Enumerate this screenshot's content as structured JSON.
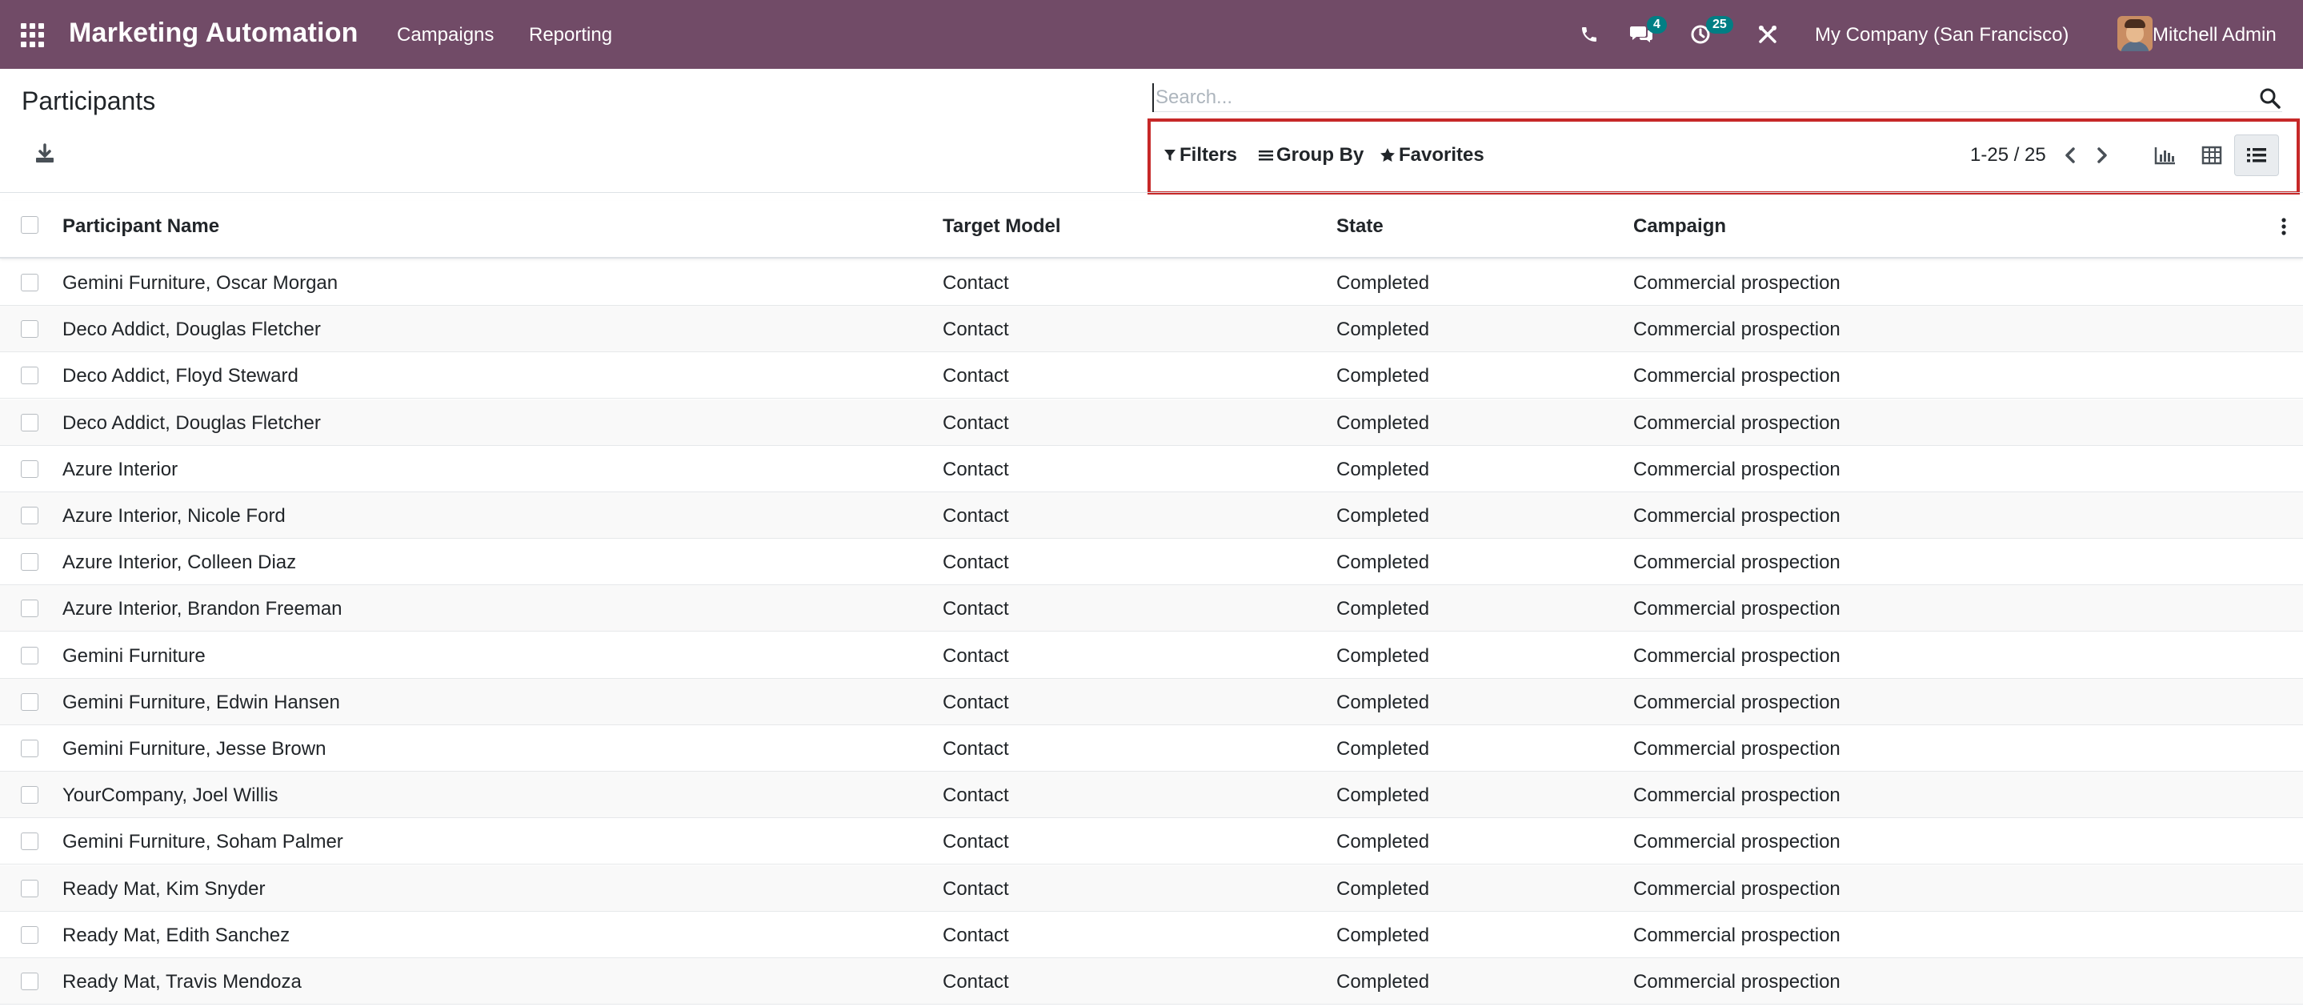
{
  "navbar": {
    "app_title": "Marketing Automation",
    "menus": [
      "Campaigns",
      "Reporting"
    ],
    "messages_count": "4",
    "activities_count": "25",
    "company": "My Company (San Francisco)",
    "user": "Mitchell Admin",
    "bg_color": "#714B67"
  },
  "control_panel": {
    "title": "Participants",
    "search_placeholder": "Search...",
    "filters_label": "Filters",
    "group_by_label": "Group By",
    "favorites_label": "Favorites",
    "pager": "1-25 / 25"
  },
  "table": {
    "columns": [
      "Participant Name",
      "Target Model",
      "State",
      "Campaign"
    ],
    "rows": [
      [
        "Gemini Furniture, Oscar Morgan",
        "Contact",
        "Completed",
        "Commercial prospection"
      ],
      [
        "Deco Addict, Douglas Fletcher",
        "Contact",
        "Completed",
        "Commercial prospection"
      ],
      [
        "Deco Addict, Floyd Steward",
        "Contact",
        "Completed",
        "Commercial prospection"
      ],
      [
        "Deco Addict, Douglas Fletcher",
        "Contact",
        "Completed",
        "Commercial prospection"
      ],
      [
        "Azure Interior",
        "Contact",
        "Completed",
        "Commercial prospection"
      ],
      [
        "Azure Interior, Nicole Ford",
        "Contact",
        "Completed",
        "Commercial prospection"
      ],
      [
        "Azure Interior, Colleen Diaz",
        "Contact",
        "Completed",
        "Commercial prospection"
      ],
      [
        "Azure Interior, Brandon Freeman",
        "Contact",
        "Completed",
        "Commercial prospection"
      ],
      [
        "Gemini Furniture",
        "Contact",
        "Completed",
        "Commercial prospection"
      ],
      [
        "Gemini Furniture, Edwin Hansen",
        "Contact",
        "Completed",
        "Commercial prospection"
      ],
      [
        "Gemini Furniture, Jesse Brown",
        "Contact",
        "Completed",
        "Commercial prospection"
      ],
      [
        "YourCompany, Joel Willis",
        "Contact",
        "Completed",
        "Commercial prospection"
      ],
      [
        "Gemini Furniture, Soham Palmer",
        "Contact",
        "Completed",
        "Commercial prospection"
      ],
      [
        "Ready Mat, Kim Snyder",
        "Contact",
        "Completed",
        "Commercial prospection"
      ],
      [
        "Ready Mat, Edith Sanchez",
        "Contact",
        "Completed",
        "Commercial prospection"
      ],
      [
        "Ready Mat, Travis Mendoza",
        "Contact",
        "Completed",
        "Commercial prospection"
      ]
    ]
  },
  "icons": [
    "apps-menu-icon",
    "phone-icon",
    "chat-icon",
    "clock-icon",
    "tools-icon",
    "search-icon",
    "download-icon",
    "filter-icon",
    "group-by-icon",
    "star-icon",
    "chevron-left-icon",
    "chevron-right-icon",
    "graph-view-icon",
    "pivot-view-icon",
    "list-view-icon",
    "kebab-menu-icon"
  ]
}
